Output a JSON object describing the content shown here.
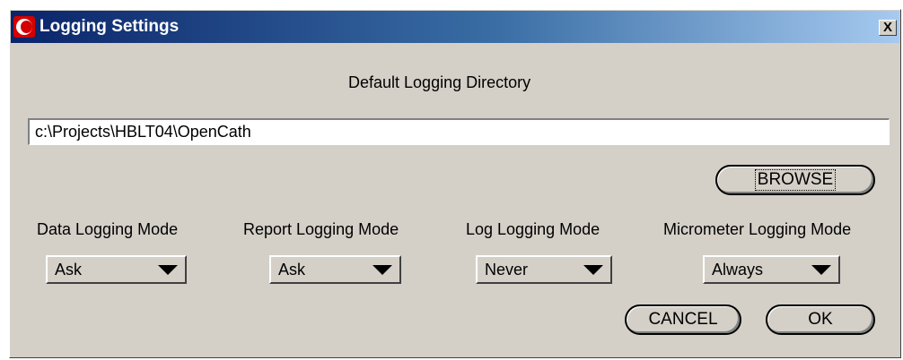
{
  "window": {
    "title": "Logging Settings",
    "close_label": "X"
  },
  "directory": {
    "label": "Default Logging Directory",
    "value": "c:\\Projects\\HBLT04\\OpenCath"
  },
  "buttons": {
    "browse": "BROWSE",
    "cancel": "CANCEL",
    "ok": "OK"
  },
  "modes": [
    {
      "label": "Data Logging Mode",
      "value": "Ask"
    },
    {
      "label": "Report Logging Mode",
      "value": "Ask"
    },
    {
      "label": "Log Logging Mode",
      "value": "Never"
    },
    {
      "label": "Micrometer Logging Mode",
      "value": "Always"
    }
  ],
  "icons": {
    "app": "red-crescent-logo-icon",
    "close": "close-icon",
    "dropdown": "chevron-down-icon"
  },
  "colors": {
    "titlebar_start": "#0a246a",
    "titlebar_end": "#a6caf0",
    "dialog_face": "#d4d0c8"
  }
}
